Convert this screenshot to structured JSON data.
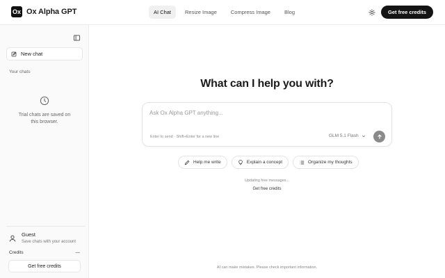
{
  "header": {
    "brand": "Ox Alpha GPT",
    "logo_text": "Ox",
    "nav": [
      {
        "label": "AI Chat",
        "active": true
      },
      {
        "label": "Resize Image",
        "active": false
      },
      {
        "label": "Compress Image",
        "active": false
      },
      {
        "label": "Blog",
        "active": false
      }
    ],
    "theme_icon": "sun-icon",
    "cta": "Get free credits"
  },
  "sidebar": {
    "collapse_icon": "sidebar-toggle-icon",
    "new_chat": "New chat",
    "your_chats": "Your chats",
    "empty_text": "Trial chats are saved on this browser.",
    "guest": {
      "name": "Guest",
      "subtitle": "Save chats with your account"
    },
    "credits_label": "Credits",
    "credits_value": "—",
    "credits_button": "Get free credits"
  },
  "main": {
    "headline": "What can I help you with?",
    "composer": {
      "placeholder": "Ask Ox Alpha GPT anything...",
      "hint": "Enter to send · Shift+Enter for a new line",
      "model": "GLM 5.1 Flash"
    },
    "suggestions": [
      {
        "label": "Help me write",
        "icon": "pencil-icon"
      },
      {
        "label": "Explain a concept",
        "icon": "lightbulb-icon"
      },
      {
        "label": "Organize my thoughts",
        "icon": "list-icon"
      }
    ],
    "status_text": "Updating free messages...",
    "status_link": "Get free credits",
    "footer": "AI can make mistakes. Please check important information."
  },
  "colors": {
    "accent": "#141414",
    "send_button": "#8a8a8a",
    "sidebar_bg": "#fafafa"
  }
}
